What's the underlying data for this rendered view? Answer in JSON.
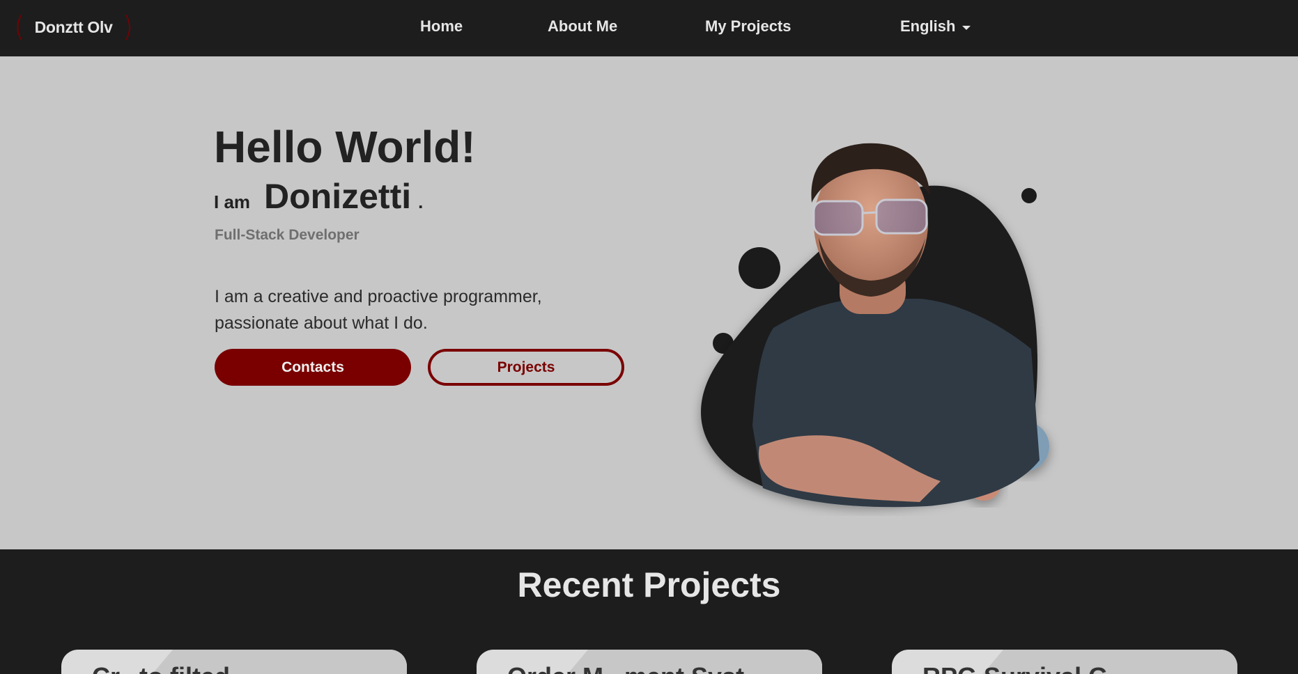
{
  "navbar": {
    "logo_text": "Donztt Olv",
    "links": [
      "Home",
      "About Me",
      "My Projects"
    ],
    "language": "English"
  },
  "hero": {
    "greeting": "Hello World!",
    "intro": "I am",
    "name": "Donizetti",
    "name_suffix": ".",
    "role": "Full-Stack Developer",
    "description": "I am a creative and proactive programmer, passionate about what I do.",
    "buttons": {
      "contacts": "Contacts",
      "projects": "Projects"
    }
  },
  "recent": {
    "title": "Recent Projects",
    "cards": [
      "Cr...to filted",
      "Order M...ment Syst...",
      "RPG Survival G..."
    ]
  },
  "colors": {
    "accent": "#7a0000",
    "nav_bg": "#1d1d1d",
    "hero_bg": "#c7c7c7",
    "text_dark": "#222222"
  },
  "icons": {
    "language_caret": "caret-down-icon"
  }
}
